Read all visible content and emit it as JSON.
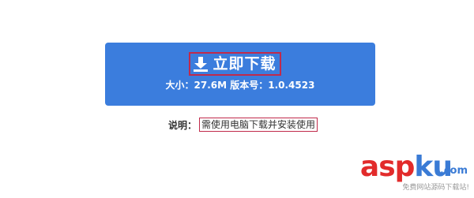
{
  "download_button": {
    "title": "立即下载",
    "meta": "大小：27.6M 版本号：1.0.4523",
    "icon": "download-icon",
    "bg_color": "#3b7ddd",
    "highlight_color": "#c02a4b"
  },
  "note": {
    "label": "说明：",
    "text": "需使用电脑下载并安装使用"
  },
  "watermark": {
    "logo_part1": "asp",
    "logo_part2": "ku",
    "dotcom": ".com",
    "subtitle": "免费网站源码下载站!"
  }
}
